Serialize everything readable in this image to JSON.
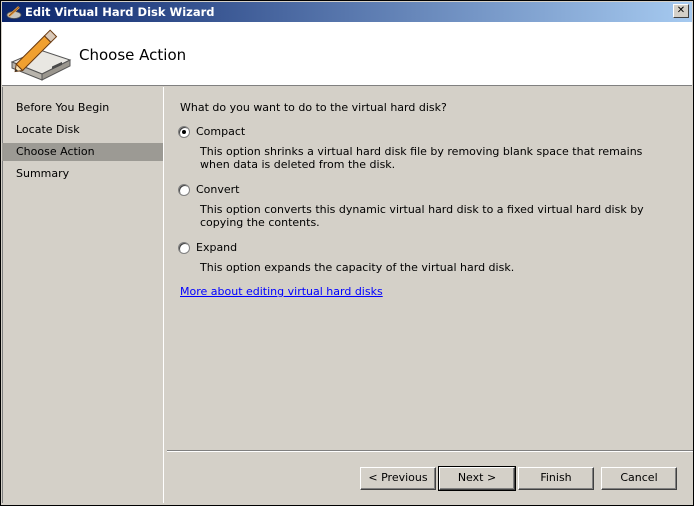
{
  "window": {
    "title": "Edit Virtual Hard Disk Wizard",
    "close_glyph": "✕"
  },
  "header": {
    "title": "Choose Action",
    "icon": "disk-edit-icon"
  },
  "nav": {
    "items": [
      {
        "label": "Before You Begin",
        "active": false
      },
      {
        "label": "Locate Disk",
        "active": false
      },
      {
        "label": "Choose Action",
        "active": true
      },
      {
        "label": "Summary",
        "active": false
      }
    ]
  },
  "content": {
    "question": "What do you want to do to the virtual hard disk?",
    "options": [
      {
        "label": "Compact",
        "selected": true,
        "description": "This option shrinks a virtual hard disk file by removing blank space that remains when data is deleted from the disk."
      },
      {
        "label": "Convert",
        "selected": false,
        "description": "This option converts this dynamic virtual hard disk to a fixed virtual hard disk by copying the contents."
      },
      {
        "label": "Expand",
        "selected": false,
        "description": "This option expands the capacity of the virtual hard disk."
      }
    ],
    "link_text": "More about editing virtual hard disks"
  },
  "footer": {
    "previous_label": "< Previous",
    "next_label": "Next >",
    "finish_label": "Finish",
    "cancel_label": "Cancel"
  }
}
